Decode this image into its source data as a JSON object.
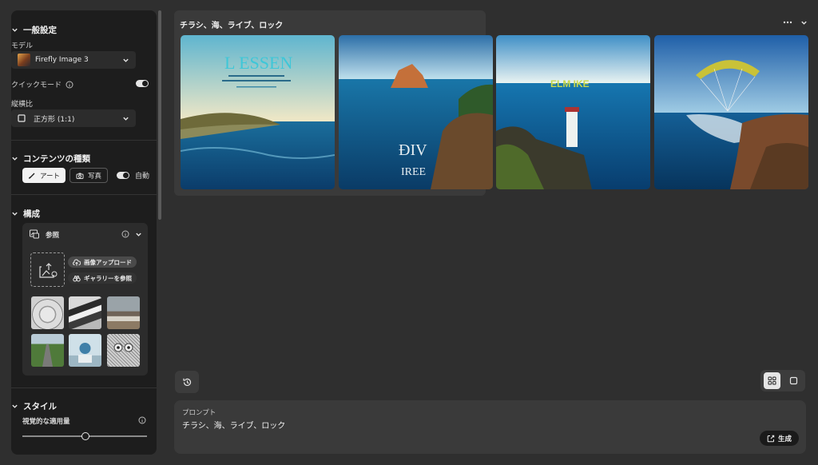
{
  "sidebar": {
    "general": {
      "title": "一般設定",
      "model_label": "モデル",
      "model_value": "Firefly Image 3",
      "quick_mode_label": "クイックモード",
      "quick_mode_on": true,
      "aspect_label": "縦横比",
      "aspect_value": "正方形 (1:1)"
    },
    "content_type": {
      "title": "コンテンツの種類",
      "art_label": "アート",
      "photo_label": "写真",
      "auto_label": "自動",
      "auto_on": true
    },
    "composition": {
      "title": "構成",
      "reference_label": "参照",
      "upload_label": "画像アップロード",
      "gallery_label": "ギャラリーを参照",
      "thumbnails": [
        "sketch-hand",
        "mountain-wave",
        "living-room",
        "green-road",
        "sphere-pedestal",
        "owl-sketch"
      ]
    },
    "style": {
      "title": "スタイル",
      "visual_intensity_label": "視覚的な適用量",
      "visual_intensity_value": 0.5
    }
  },
  "main": {
    "prompt_title": "チラシ、海、ライブ、ロック",
    "images": [
      "poster-coast",
      "rock-island",
      "lighthouse",
      "paraglider"
    ],
    "prompt_label": "プロンプト",
    "prompt_text": "チラシ、海、ライブ、ロック",
    "generate_label": "生成"
  },
  "colors": {
    "background": "#2f2f2f",
    "panel": "#1d1d1d",
    "accent_light": "#f2f2f2"
  }
}
